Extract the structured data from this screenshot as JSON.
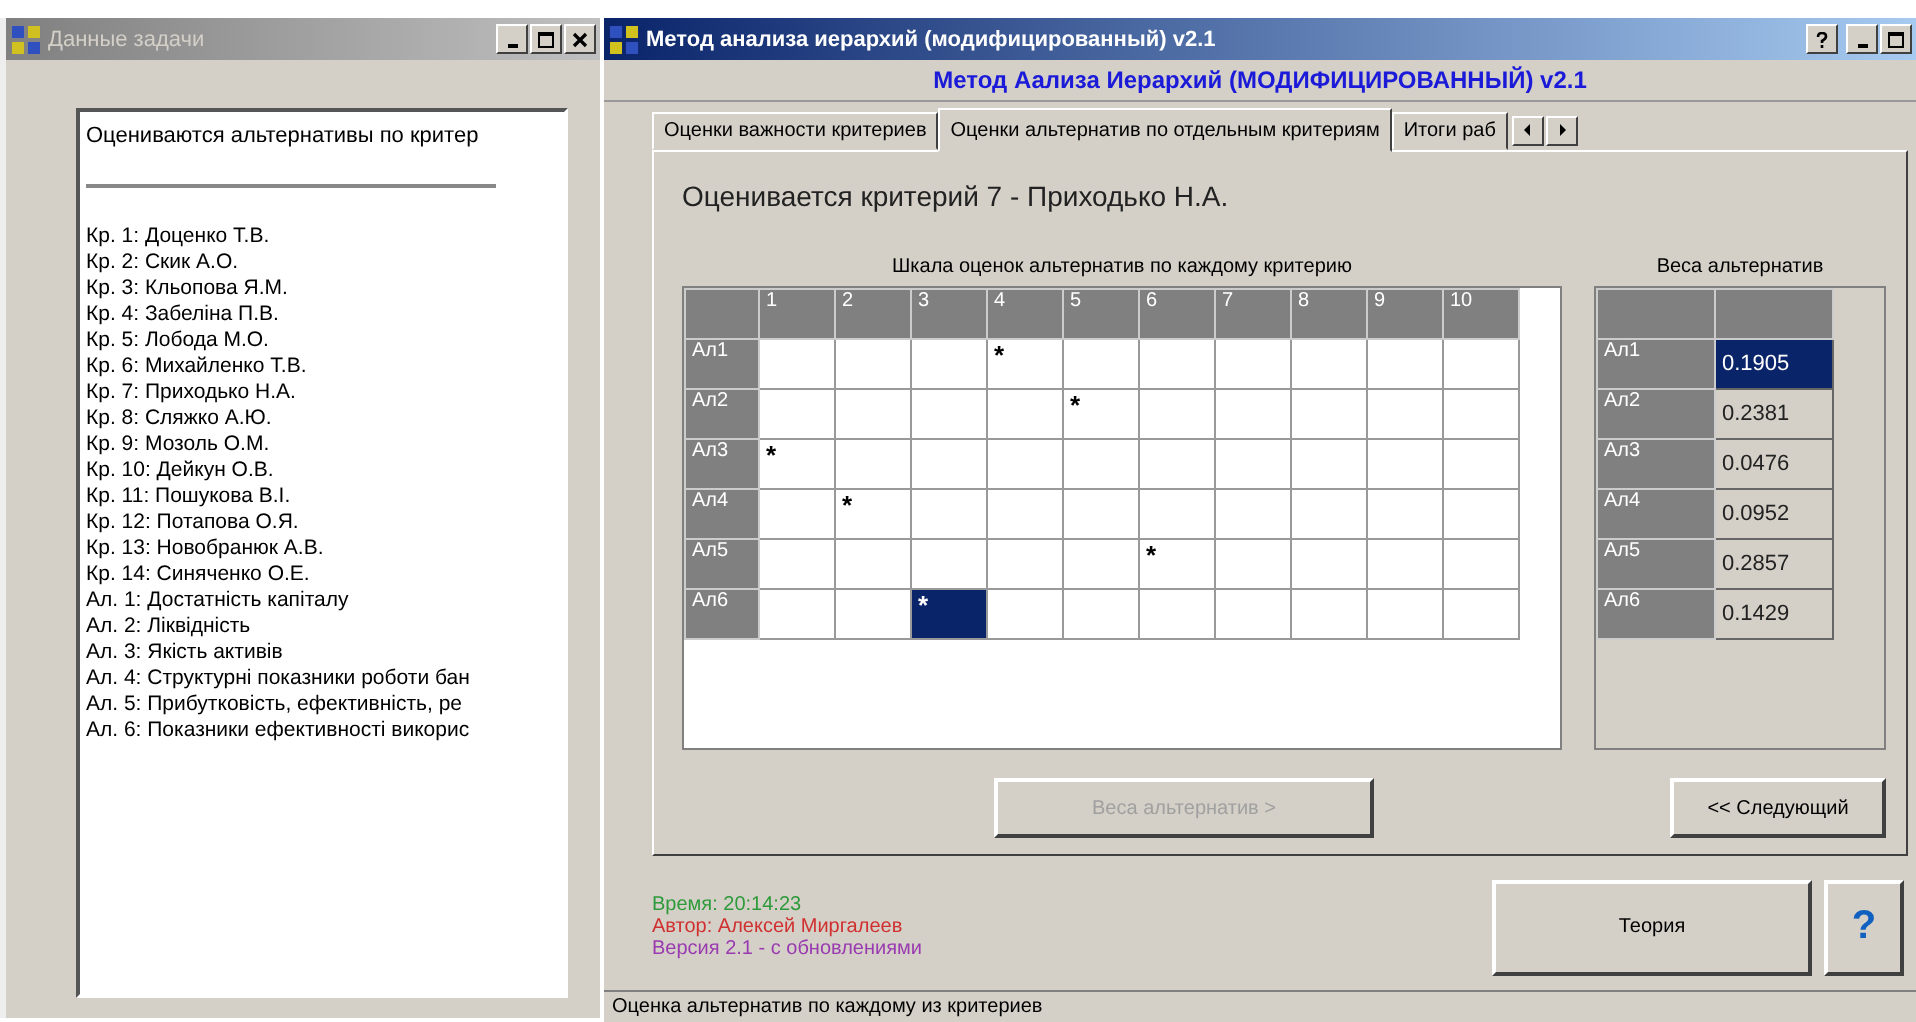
{
  "task_window": {
    "title": "Данные задачи",
    "lines": [
      {
        "text": "Оцениваются альтернативы по критер",
        "kind": "heading"
      },
      {
        "text": "Кр. 1: Доценко Т.В.",
        "kind": "item"
      },
      {
        "text": "Кр. 2: Скик А.О.",
        "kind": "item"
      },
      {
        "text": "Кр. 3: Кльопова Я.М.",
        "kind": "item"
      },
      {
        "text": "Кр. 4: Забеліна П.В.",
        "kind": "item"
      },
      {
        "text": "Кр. 5: Лобода М.О.",
        "kind": "item"
      },
      {
        "text": "Кр. 6: Михайленко Т.В.",
        "kind": "item"
      },
      {
        "text": "Кр. 7: Приходько Н.А.",
        "kind": "item"
      },
      {
        "text": "Кр. 8: Сляжко А.Ю.",
        "kind": "item"
      },
      {
        "text": "Кр. 9: Мозоль О.М.",
        "kind": "item"
      },
      {
        "text": "Кр. 10: Дейкун О.В.",
        "kind": "item"
      },
      {
        "text": "Кр. 11: Пошукова В.І.",
        "kind": "item"
      },
      {
        "text": "Кр. 12: Потапова О.Я.",
        "kind": "item"
      },
      {
        "text": "Кр. 13: Новобранюк А.В.",
        "kind": "item"
      },
      {
        "text": "Кр. 14: Синяченко О.Е.",
        "kind": "item"
      },
      {
        "text": "Ал. 1: Достатність капіталу",
        "kind": "item"
      },
      {
        "text": "Ал. 2: Ліквідність",
        "kind": "item"
      },
      {
        "text": "Ал. 3: Якість активів",
        "kind": "item"
      },
      {
        "text": "Ал. 4: Структурні показники роботи бан",
        "kind": "item"
      },
      {
        "text": "Ал. 5: Прибутковість, ефективність, ре",
        "kind": "item"
      },
      {
        "text": "Ал. 6: Показники ефективності викорис",
        "kind": "item"
      }
    ]
  },
  "main_window": {
    "title": "Метод анализа иерархий (модифицированный)  v2.1",
    "header": "Метод Аализа Иерархий (МОДИФИЦИРОВАННЫЙ) v2.1",
    "tabs": [
      {
        "label": "Оценки важности критериев",
        "selected": false
      },
      {
        "label": "Оценки альтернатив по отдельным критериям",
        "selected": true
      },
      {
        "label": "Итоги раб",
        "selected": false
      }
    ],
    "criterion": "Оценивается критерий 7 - Приходько Н.А.",
    "scale": {
      "title": "Шкала оценок альтернатив по каждому критерию",
      "columns": [
        "1",
        "2",
        "3",
        "4",
        "5",
        "6",
        "7",
        "8",
        "9",
        "10"
      ],
      "rows": [
        {
          "label": "Ал1",
          "cells": [
            {
              "selected": false
            },
            {
              "selected": false
            },
            {
              "selected": false
            },
            {
              "mark": "*",
              "selected": false
            },
            {
              "selected": false
            },
            {
              "selected": false
            },
            {
              "selected": false
            },
            {
              "selected": false
            },
            {
              "selected": false
            },
            {
              "selected": false
            }
          ]
        },
        {
          "label": "Ал2",
          "cells": [
            {
              "selected": false
            },
            {
              "selected": false
            },
            {
              "selected": false
            },
            {
              "selected": false
            },
            {
              "mark": "*",
              "selected": false
            },
            {
              "selected": false
            },
            {
              "selected": false
            },
            {
              "selected": false
            },
            {
              "selected": false
            },
            {
              "selected": false
            }
          ]
        },
        {
          "label": "Ал3",
          "cells": [
            {
              "mark": "*",
              "selected": false
            },
            {
              "selected": false
            },
            {
              "selected": false
            },
            {
              "selected": false
            },
            {
              "selected": false
            },
            {
              "selected": false
            },
            {
              "selected": false
            },
            {
              "selected": false
            },
            {
              "selected": false
            },
            {
              "selected": false
            }
          ]
        },
        {
          "label": "Ал4",
          "cells": [
            {
              "selected": false
            },
            {
              "mark": "*",
              "selected": false
            },
            {
              "selected": false
            },
            {
              "selected": false
            },
            {
              "selected": false
            },
            {
              "selected": false
            },
            {
              "selected": false
            },
            {
              "selected": false
            },
            {
              "selected": false
            },
            {
              "selected": false
            }
          ]
        },
        {
          "label": "Ал5",
          "cells": [
            {
              "selected": false
            },
            {
              "selected": false
            },
            {
              "selected": false
            },
            {
              "selected": false
            },
            {
              "selected": false
            },
            {
              "mark": "*",
              "selected": false
            },
            {
              "selected": false
            },
            {
              "selected": false
            },
            {
              "selected": false
            },
            {
              "selected": false
            }
          ]
        },
        {
          "label": "Ал6",
          "cells": [
            {
              "selected": false
            },
            {
              "selected": false
            },
            {
              "mark": "*",
              "selected": true
            },
            {
              "selected": false
            },
            {
              "selected": false
            },
            {
              "selected": false
            },
            {
              "selected": false
            },
            {
              "selected": false
            },
            {
              "selected": false
            },
            {
              "selected": false
            }
          ]
        }
      ]
    },
    "weights": {
      "title": "Веса альтернатив",
      "rows": [
        {
          "label": "Ал1",
          "value": "0.1905",
          "selected": true
        },
        {
          "label": "Ал2",
          "value": "0.2381",
          "selected": false
        },
        {
          "label": "Ал3",
          "value": "0.0476",
          "selected": false
        },
        {
          "label": "Ал4",
          "value": "0.0952",
          "selected": false
        },
        {
          "label": "Ал5",
          "value": "0.2857",
          "selected": false
        },
        {
          "label": "Ал6",
          "value": "0.1429",
          "selected": false
        }
      ]
    },
    "weights_button": {
      "label": "Веса альтернатив >",
      "disabled": true
    },
    "next_button": {
      "label": "<< Следующий",
      "disabled": false
    },
    "info": [
      {
        "text": "Время: 20:14:23",
        "color": "#2e9a3a"
      },
      {
        "text": "Автор: Алексей Миргалеев",
        "color": "#d03030"
      },
      {
        "text": "Версия 2.1 - с обновлениями",
        "color": "#9a3ab0"
      }
    ],
    "theory_button": "Теория",
    "help_button": "?",
    "status_bar": "Оценка альтернатив по каждому из критериев"
  }
}
